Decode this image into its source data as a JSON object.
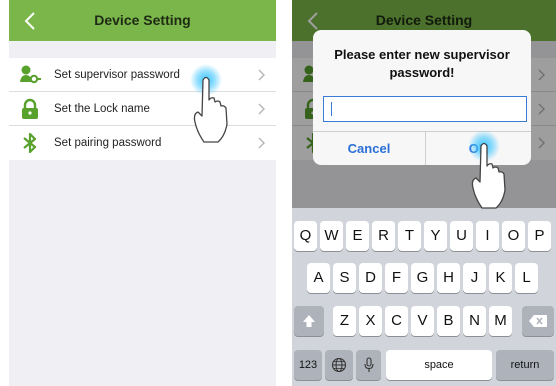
{
  "left_screen": {
    "header": {
      "title": "Device Setting"
    },
    "items": [
      {
        "label": "Set supervisor password",
        "icon": "key-user-icon"
      },
      {
        "label": "Set the Lock name",
        "icon": "lock-icon"
      },
      {
        "label": "Set pairing password",
        "icon": "bluetooth-icon"
      }
    ]
  },
  "right_screen": {
    "header": {
      "title": "Device Setting"
    },
    "dialog": {
      "message": "Please enter new supervisor password!",
      "input_value": "",
      "cancel_label": "Cancel",
      "ok_label": "OK"
    },
    "keyboard": {
      "row1": [
        "Q",
        "W",
        "E",
        "R",
        "T",
        "Y",
        "U",
        "I",
        "O",
        "P"
      ],
      "row2": [
        "A",
        "S",
        "D",
        "F",
        "G",
        "H",
        "J",
        "K",
        "L"
      ],
      "row3": [
        "Z",
        "X",
        "C",
        "V",
        "B",
        "N",
        "M"
      ],
      "numbers_label": "123",
      "space_label": "space",
      "return_label": "return"
    }
  },
  "colors": {
    "header_green": "#7ab64a",
    "icon_green": "#57a12c",
    "dialog_blue": "#2b6fd6",
    "tap_glow": "#3ec6ff"
  }
}
